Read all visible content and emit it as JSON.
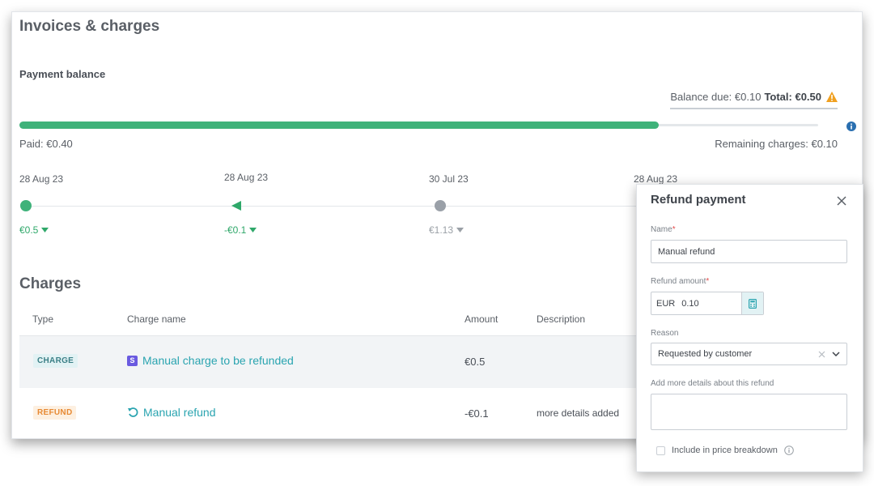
{
  "page": {
    "title": "Invoices & charges",
    "payment_balance_title": "Payment balance",
    "balance_due": "Balance due: €0.10",
    "total": "Total: €0.50",
    "progress_paid_fraction": 0.8,
    "paid": "Paid: €0.40",
    "remaining": "Remaining charges: €0.10"
  },
  "timeline": [
    {
      "date": "28 Aug 23",
      "amount": "€0.5",
      "kind": "paid"
    },
    {
      "date": "28 Aug 23",
      "amount": "-€0.1",
      "kind": "refund"
    },
    {
      "date": "30 Jul 23",
      "amount": "€1.13",
      "kind": "pending"
    },
    {
      "date": "28 Aug 23",
      "amount": "",
      "kind": "other"
    }
  ],
  "charges": {
    "title": "Charges",
    "columns": [
      "Type",
      "Charge name",
      "Amount",
      "Description"
    ],
    "rows": [
      {
        "type": "CHARGE",
        "name": "Manual charge to be refunded",
        "amount": "€0.5",
        "description": ""
      },
      {
        "type": "REFUND",
        "name": "Manual refund",
        "amount": "-€0.1",
        "description": "more details added"
      }
    ]
  },
  "modal": {
    "title": "Refund payment",
    "name_label": "Name",
    "name_value": "Manual refund",
    "amount_label": "Refund amount",
    "currency": "EUR",
    "amount_value": "0.10",
    "reason_label": "Reason",
    "reason_value": "Requested by customer",
    "details_label": "Add more details about this refund",
    "checkbox_label": "Include in price breakdown",
    "required_mark": "*"
  },
  "colors": {
    "accent_green": "#3fb27a",
    "link_teal": "#2aa4b0",
    "warning": "#f0a020"
  }
}
